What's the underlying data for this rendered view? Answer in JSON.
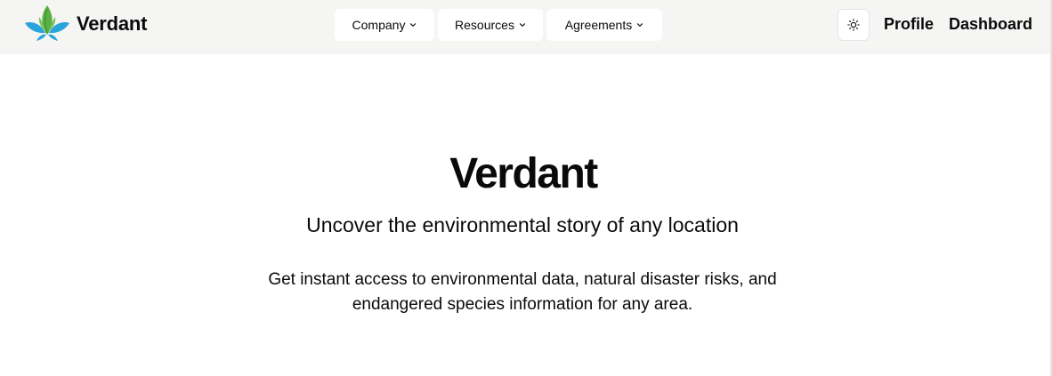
{
  "brand": {
    "name": "Verdant",
    "logo_icon": "leaf-lotus-logo",
    "colors": {
      "leaf": "#5bb043",
      "petal": "#2aa4dc"
    }
  },
  "nav": {
    "menus": [
      {
        "label": "Company",
        "icon": "chevron-down-icon"
      },
      {
        "label": "Resources",
        "icon": "chevron-down-icon"
      },
      {
        "label": "Agreements",
        "icon": "chevron-down-icon"
      }
    ],
    "theme_toggle_icon": "sun-icon",
    "links": {
      "profile": "Profile",
      "dashboard": "Dashboard"
    },
    "background": "#f5f5f4"
  },
  "hero": {
    "title": "Verdant",
    "subtitle": "Uncover the environmental story of any location",
    "description": "Get instant access to environmental data, natural disaster risks, and endangered species information for any area."
  }
}
